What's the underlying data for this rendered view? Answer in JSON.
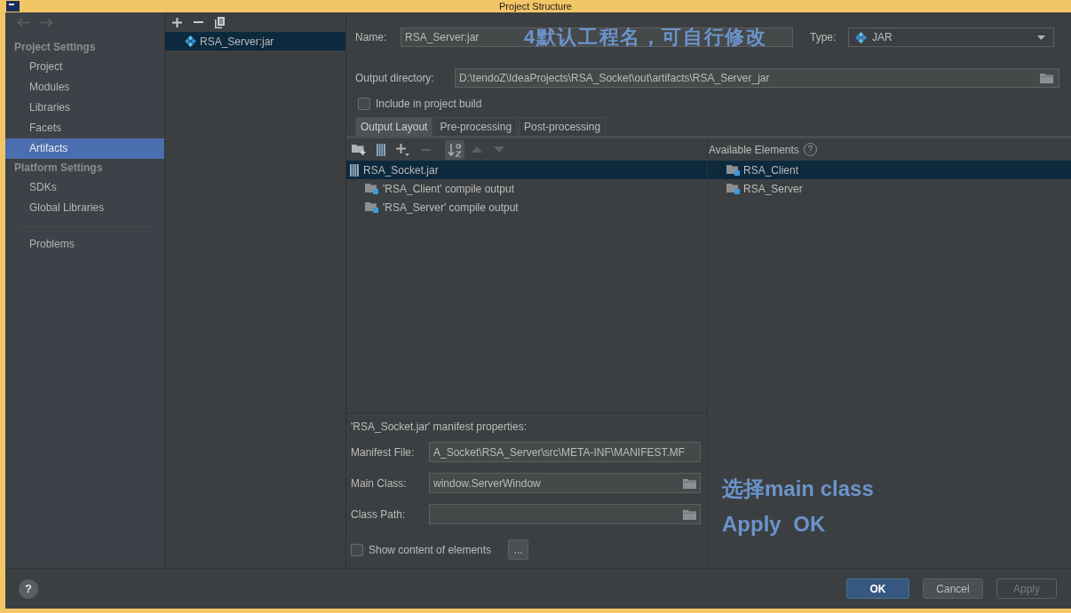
{
  "window": {
    "title": "Project Structure"
  },
  "nav_buttons": [
    {
      "kind": "back",
      "disabled": true
    },
    {
      "kind": "forward",
      "disabled": true
    }
  ],
  "sidebar": {
    "sections": [
      {
        "title": "Project Settings",
        "items": [
          {
            "label": "Project",
            "selected": false
          },
          {
            "label": "Modules",
            "selected": false
          },
          {
            "label": "Libraries",
            "selected": false
          },
          {
            "label": "Facets",
            "selected": false
          },
          {
            "label": "Artifacts",
            "selected": true
          }
        ]
      },
      {
        "title": "Platform Settings",
        "items": [
          {
            "label": "SDKs",
            "selected": false
          },
          {
            "label": "Global Libraries",
            "selected": false
          }
        ]
      }
    ],
    "footer_items": [
      {
        "label": "Problems",
        "selected": false
      }
    ]
  },
  "artifacts": {
    "items": [
      {
        "label": "RSA_Server:jar",
        "selected": true
      }
    ]
  },
  "artifact": {
    "name_label": "Name:",
    "name": "RSA_Server:jar",
    "type_label": "Type:",
    "type": "JAR",
    "output_label": "Output directory:",
    "output": "D:\\tendoZ\\IdeaProjects\\RSA_Socket\\out\\artifacts\\RSA_Server_jar",
    "include_in_build": {
      "label": "Include in project build",
      "checked": false
    }
  },
  "tabs": [
    {
      "label": "Output Layout",
      "selected": true
    },
    {
      "label": "Pre-processing",
      "selected": false
    },
    {
      "label": "Post-processing",
      "selected": false
    }
  ],
  "layout_toolbar": [
    {
      "kind": "new-folder",
      "disabled": false,
      "on": false
    },
    {
      "kind": "archive",
      "disabled": false,
      "on": false
    },
    {
      "kind": "add",
      "disabled": false,
      "on": false
    },
    {
      "kind": "remove",
      "disabled": true,
      "on": false
    },
    {
      "kind": "sort",
      "disabled": false,
      "on": true
    },
    {
      "kind": "move-up",
      "disabled": true,
      "on": false
    },
    {
      "kind": "move-down",
      "disabled": true,
      "on": false
    }
  ],
  "output_tree": [
    {
      "label": "RSA_Socket.jar",
      "kind": "archive",
      "selected": true,
      "children": [
        {
          "label": "'RSA_Client' compile output",
          "kind": "module-output",
          "selected": false
        },
        {
          "label": "'RSA_Server' compile output",
          "kind": "module-output",
          "selected": false
        }
      ]
    }
  ],
  "available_elements": {
    "title": "Available Elements",
    "help": "?",
    "items": [
      {
        "label": "RSA_Client",
        "selected": true
      },
      {
        "label": "RSA_Server",
        "selected": false
      }
    ]
  },
  "manifest": {
    "title": "'RSA_Socket.jar' manifest properties:",
    "fields": [
      {
        "label": "Manifest File:",
        "value": "A_Socket\\RSA_Server\\src\\META-INF\\MANIFEST.MF",
        "browse": false
      },
      {
        "label": "Main Class:",
        "value": "window.ServerWindow",
        "browse": true
      },
      {
        "label": "Class Path:",
        "browse": true
      }
    ],
    "show_content": {
      "label": "Show content of elements",
      "checked": false
    },
    "more_button": "..."
  },
  "annotations": [
    "4默认工程名，可自行修改",
    "选择main class",
    "Apply OK"
  ],
  "footer": {
    "help": "?",
    "buttons": [
      {
        "label": "OK",
        "kind": "default",
        "disabled": false
      },
      {
        "label": "Cancel",
        "kind": "normal",
        "disabled": false
      },
      {
        "label": "Apply",
        "kind": "normal",
        "disabled": true
      }
    ]
  }
}
